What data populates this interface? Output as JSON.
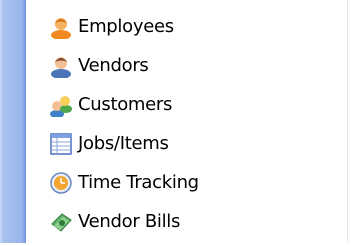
{
  "nav": {
    "items": [
      {
        "label": "Employees",
        "icon": "employees-icon"
      },
      {
        "label": "Vendors",
        "icon": "vendors-icon"
      },
      {
        "label": "Customers",
        "icon": "customers-icon"
      },
      {
        "label": "Jobs/Items",
        "icon": "jobs-items-icon"
      },
      {
        "label": "Time Tracking",
        "icon": "time-tracking-icon"
      },
      {
        "label": "Vendor Bills",
        "icon": "vendor-bills-icon"
      }
    ]
  },
  "colors": {
    "strip": "#98b4ea",
    "text": "#000000",
    "background": "#ffffff"
  }
}
